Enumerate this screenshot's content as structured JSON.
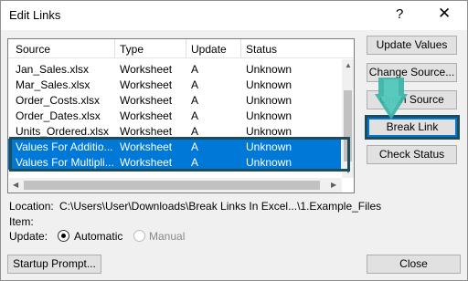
{
  "window": {
    "title": "Edit Links",
    "help_label": "?",
    "close_label": "✕"
  },
  "columns": [
    "Source",
    "Type",
    "Update",
    "Status"
  ],
  "rows": [
    {
      "source": "Jan_Sales.xlsx",
      "type": "Worksheet",
      "update": "A",
      "status": "Unknown",
      "selected": false
    },
    {
      "source": "Mar_Sales.xlsx",
      "type": "Worksheet",
      "update": "A",
      "status": "Unknown",
      "selected": false
    },
    {
      "source": "Order_Costs.xlsx",
      "type": "Worksheet",
      "update": "A",
      "status": "Unknown",
      "selected": false
    },
    {
      "source": "Order_Dates.xlsx",
      "type": "Worksheet",
      "update": "A",
      "status": "Unknown",
      "selected": false
    },
    {
      "source": "Units_Ordered.xlsx",
      "type": "Worksheet",
      "update": "A",
      "status": "Unknown",
      "selected": false
    },
    {
      "source": "Values For Additio...",
      "type": "Worksheet",
      "update": "A",
      "status": "Unknown",
      "selected": true
    },
    {
      "source": "Values For Multipli...",
      "type": "Worksheet",
      "update": "A",
      "status": "Unknown",
      "selected": true
    }
  ],
  "buttons": {
    "update_values": "Update Values",
    "change_source": "Change Source...",
    "open_source": "Open Source",
    "break_link": "Break Link",
    "check_status": "Check Status"
  },
  "details": {
    "location_label": "Location:",
    "location_value": "C:\\Users\\User\\Downloads\\Break Links In Excel...\\1.Example_Files",
    "item_label": "Item:",
    "update_label": "Update:",
    "automatic_label": "Automatic",
    "manual_label": "Manual"
  },
  "footer": {
    "startup_prompt": "Startup Prompt...",
    "close": "Close"
  },
  "colors": {
    "selection": "#0078d7",
    "highlight_border": "#1e4d59",
    "pointer": "#3ab3a6"
  }
}
